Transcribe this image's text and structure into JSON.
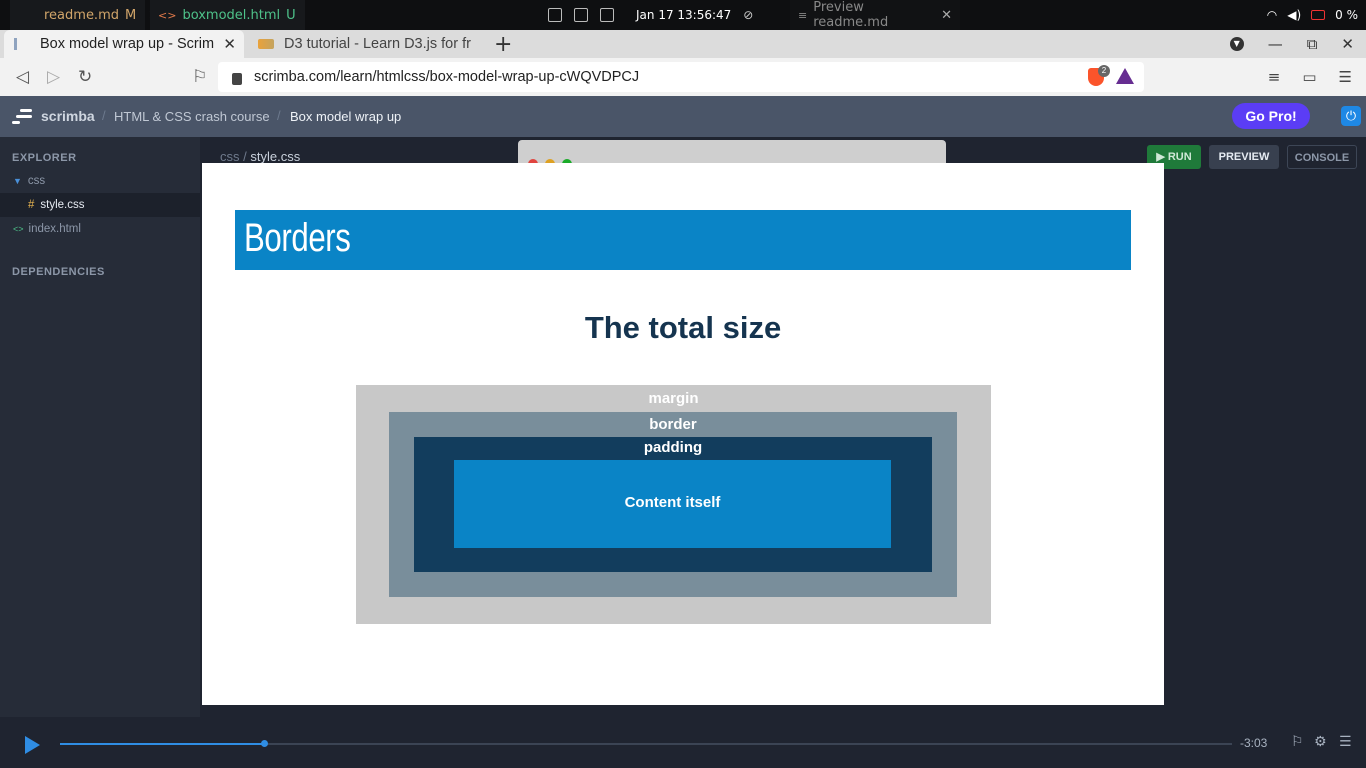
{
  "os": {
    "tabs": [
      {
        "label": "readme.md",
        "status": "M"
      },
      {
        "label": "boxmodel.html",
        "status": "U"
      },
      {
        "label": "Preview readme.md"
      }
    ],
    "clock": "Jan 17  13:56:47",
    "battery": "0 %"
  },
  "browser": {
    "tabs": [
      {
        "title": "Box model wrap up - Scrim",
        "active": true
      },
      {
        "title": "D3 tutorial - Learn D3.js for fr",
        "active": false
      }
    ],
    "url": "scrimba.com/learn/htmlcss/box-model-wrap-up-cWQVDPCJ",
    "brave_badge": "2"
  },
  "scrimba": {
    "brand": "scrimba",
    "breadcrumb": [
      "HTML & CSS crash course",
      "Box model wrap up"
    ],
    "gopro_label": "Go Pro!"
  },
  "sidebar": {
    "explorer_label": "EXPLORER",
    "folder": "css",
    "files": [
      {
        "name": "style.css",
        "icon": "#",
        "selected": true
      },
      {
        "name": "index.html",
        "icon": "<>",
        "selected": false
      }
    ],
    "dependencies_label": "DEPENDENCIES"
  },
  "editor": {
    "path_dir": "css",
    "path_sep": "/",
    "path_file": "style.css",
    "buttons": {
      "run": "RUN",
      "preview": "PREVIEW",
      "console": "CONSOLE"
    }
  },
  "slide": {
    "banner": "Borders",
    "title": "The total size",
    "labels": {
      "margin": "margin",
      "border": "border",
      "padding": "padding",
      "content": "Content itself"
    },
    "colors": {
      "banner": "#0a84c6",
      "margin": "#c8c8c8",
      "border": "#798e9b",
      "padding": "#123d5d",
      "content": "#0a84c6"
    }
  },
  "player": {
    "time": "-3:03",
    "progress": 0.174
  }
}
